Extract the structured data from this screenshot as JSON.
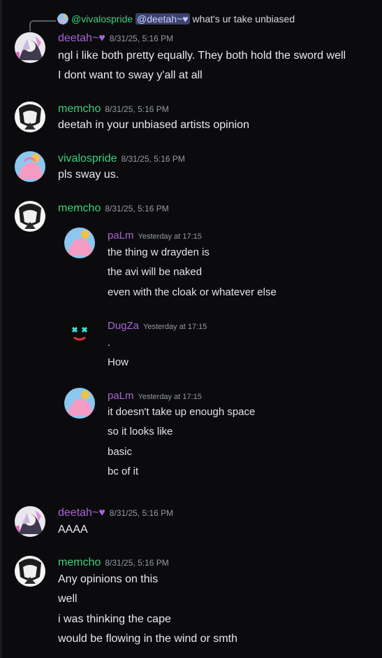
{
  "reply": {
    "author": "@vivalospride",
    "mention": "@deetah~♥",
    "text": "what's ur take unbiased"
  },
  "messages": [
    {
      "author": "deetah~♥",
      "timestamp": "8/31/25, 5:16 PM",
      "lines": [
        "ngl i like both pretty equally. They both hold the sword well",
        "I dont want to sway y'all at all"
      ]
    },
    {
      "author": "memcho",
      "timestamp": "8/31/25, 5:16 PM",
      "lines": [
        "deetah in your unbiased artists opinion"
      ]
    },
    {
      "author": "vivalospride",
      "timestamp": "8/31/25, 5:16 PM",
      "lines": [
        "pls sway us."
      ]
    },
    {
      "author": "memcho",
      "timestamp": "8/31/25, 5:16 PM",
      "lines": []
    },
    {
      "author": "deetah~♥",
      "timestamp": "8/31/25, 5:16 PM",
      "lines": [
        "AAAA"
      ]
    },
    {
      "author": "memcho",
      "timestamp": "8/31/25, 5:16 PM",
      "lines": [
        "Any opinions on this",
        "well",
        "i was thinking the cape",
        "would be flowing in the wind or smth"
      ]
    }
  ],
  "screenshot": [
    {
      "author": "paLm",
      "timestamp": "Yesterday at 17:15",
      "lines": [
        "the thing w drayden is",
        "the avi will be naked",
        "even with the cloak or whatever else"
      ]
    },
    {
      "author": "DugZa",
      "timestamp": "Yesterday at 17:15",
      "lines": [
        ".",
        "How"
      ]
    },
    {
      "author": "paLm",
      "timestamp": "Yesterday at 17:15",
      "lines": [
        "it doesn't take up enough space",
        "so it looks like",
        "basic",
        "bc of it"
      ]
    }
  ],
  "colors": {
    "deetah": "#a964d6",
    "memcho": "#3ecf7d",
    "vivalospride": "#3ecf7d",
    "palm": "#a964d6",
    "background": "#0b0b0d"
  }
}
